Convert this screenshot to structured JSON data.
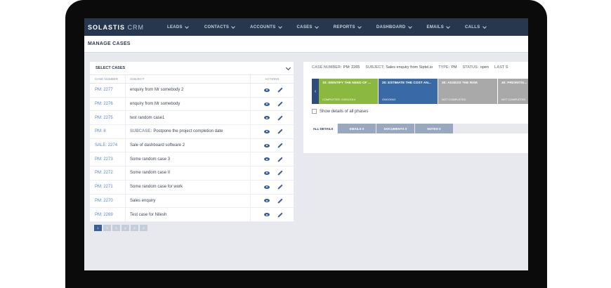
{
  "app": {
    "brand": "SOLASTIS",
    "brand_suffix": "CRM"
  },
  "nav": [
    "LEADS",
    "CONTACTS",
    "ACCOUNTS",
    "CASES",
    "REPORTS",
    "DASHBOARD",
    "EMAILS",
    "CALLS"
  ],
  "page_title": "MANAGE CASES",
  "cases_panel": {
    "header": "SELECT CASES",
    "columns": [
      "CASE NUMBER",
      "SUBJECT",
      "ACTIONS"
    ],
    "rows": [
      {
        "id": "PM: 2277",
        "subject": "enquiry from Mr somebody 2",
        "prefix": ""
      },
      {
        "id": "PM: 2276",
        "subject": "enquiry from Mr somebody",
        "prefix": ""
      },
      {
        "id": "PM: 2275",
        "subject": "test random case1",
        "prefix": ""
      },
      {
        "id": "PM: 8",
        "subject": "Postpone the project completion date",
        "prefix": "SUBCASE:"
      },
      {
        "id": "SALE: 2274",
        "subject": "Sale of dashboard software 2",
        "prefix": ""
      },
      {
        "id": "PM: 2273",
        "subject": "Some random case 3",
        "prefix": ""
      },
      {
        "id": "PM: 2272",
        "subject": "Some random case II",
        "prefix": ""
      },
      {
        "id": "PM: 2271",
        "subject": "Some random case for work",
        "prefix": ""
      },
      {
        "id": "PM: 2270",
        "subject": "Sales enquiry",
        "prefix": ""
      },
      {
        "id": "PM: 2269",
        "subject": "Test case for Nilesh",
        "prefix": ""
      }
    ],
    "pager": [
      "1",
      "2",
      "3",
      "4",
      "5",
      "6"
    ]
  },
  "case_info": {
    "number_label": "CASE NUMBER:",
    "number": "PM: 2265",
    "subject_label": "SUBJECT:",
    "subject": "Sales enquiry from Siptel.io",
    "type_label": "TYPE:",
    "type": "PM",
    "status_label": "STATUS:",
    "status": "open",
    "last_label": "LAST S"
  },
  "phases": [
    {
      "title": "10: IDENTIFY THE NEED OF ...",
      "status": "COMPLETED: 03/01/2014",
      "color": "#8bb83f"
    },
    {
      "title": "20: ESTIMATE THE COST AN...",
      "status": "ONGOING",
      "color": "#3a6aa5"
    },
    {
      "title": "30: ASSESS THE RISK",
      "status": "NOT COMPLETED",
      "color": "#a9a9a9"
    },
    {
      "title": "40: PRIORITIS...",
      "status": "NOT COMPLETED",
      "color": "#a9a9a9"
    }
  ],
  "show_details_label": "Show details of all phases",
  "tabs": [
    "ALL DETAILS",
    "EMAILS 0",
    "DOCUMENTS 0",
    "NOTES 0"
  ]
}
